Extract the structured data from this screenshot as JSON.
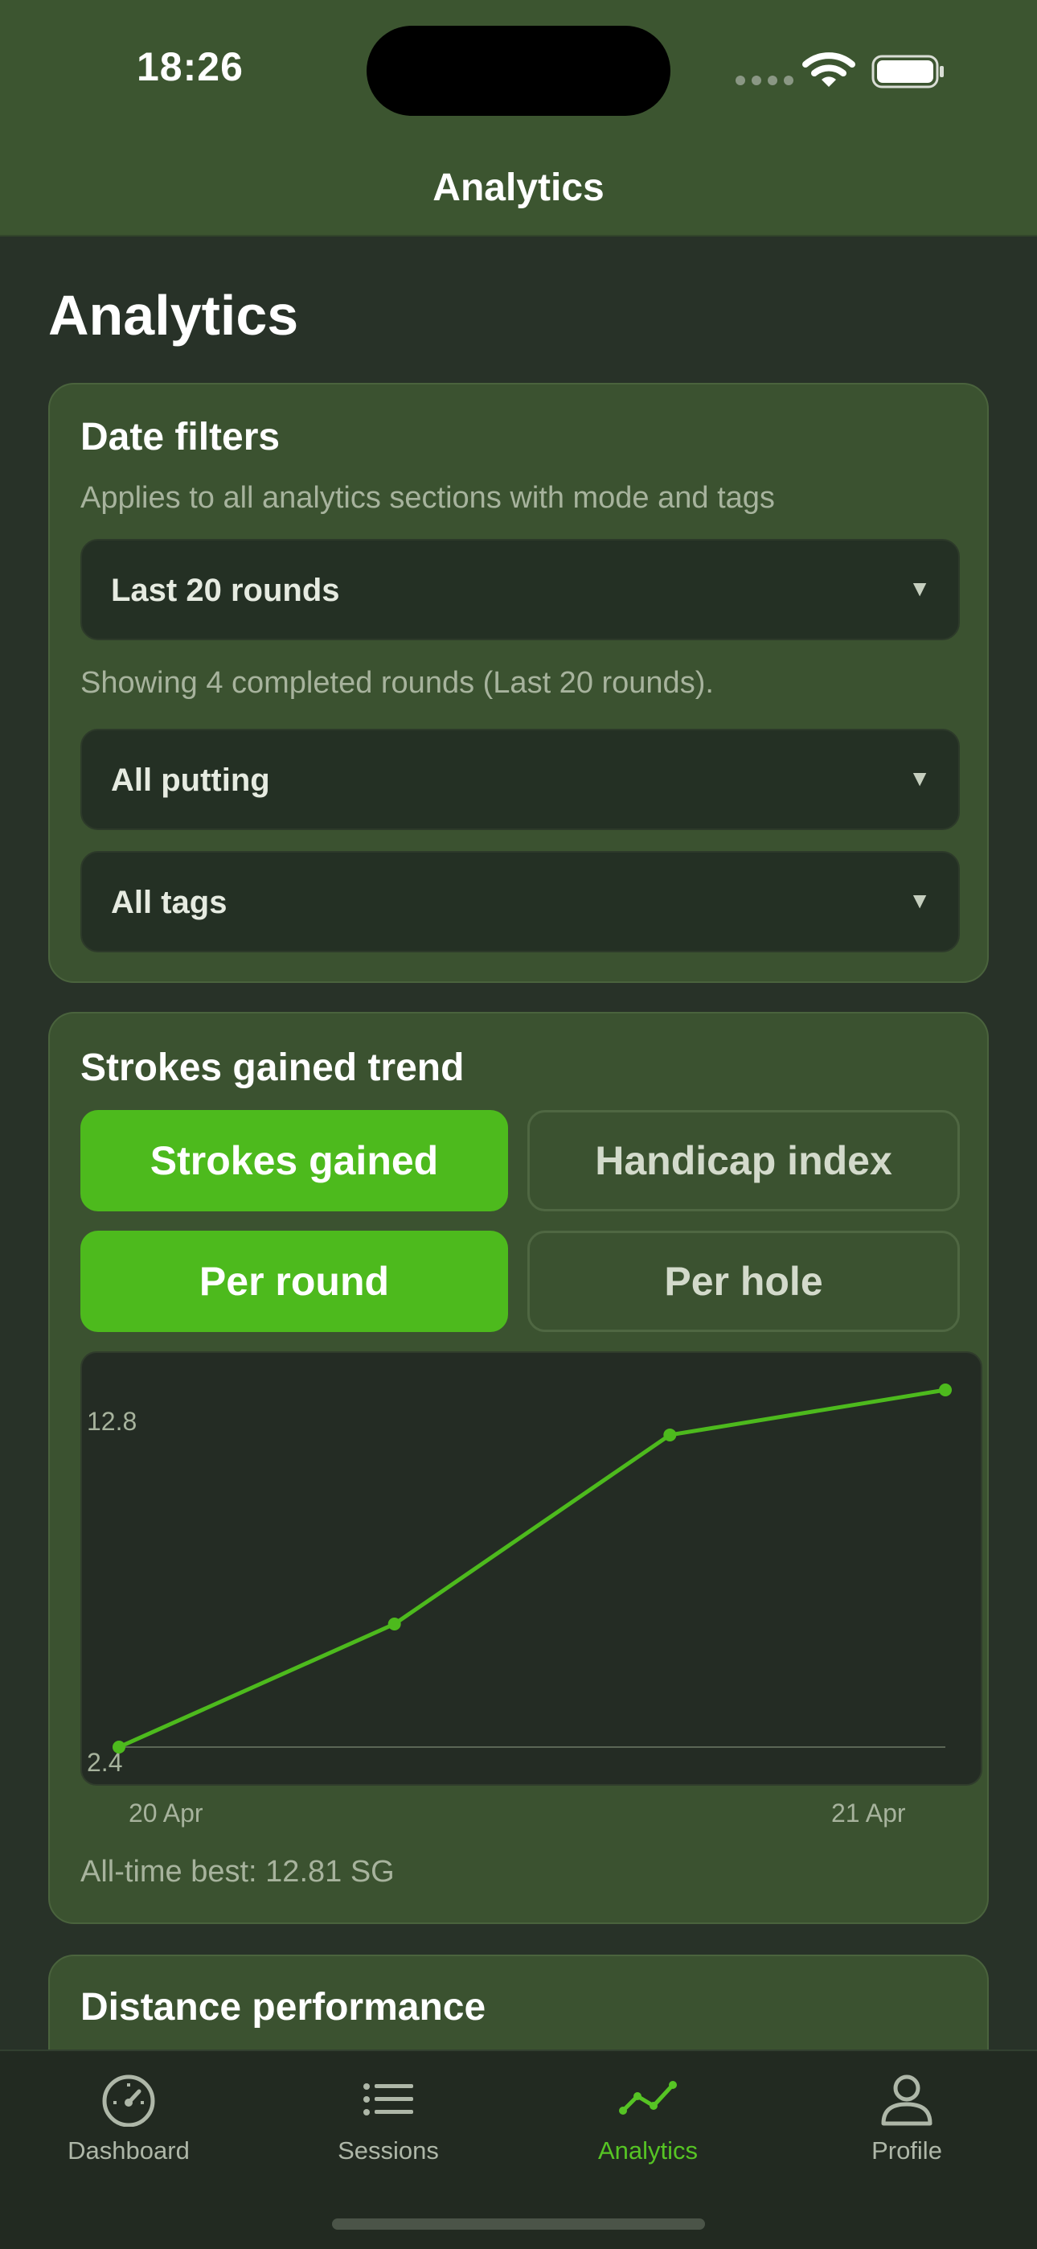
{
  "status_bar": {
    "time": "18:26"
  },
  "nav": {
    "title": "Analytics"
  },
  "page": {
    "title": "Analytics"
  },
  "date_filters": {
    "title": "Date filters",
    "subtitle": "Applies to all analytics sections with mode and tags",
    "range_select": "Last 20 rounds",
    "summary": "Showing 4 completed rounds (Last 20 rounds).",
    "mode_select": "All putting",
    "tags_select": "All tags"
  },
  "trend": {
    "title": "Strokes gained trend",
    "metric_options": [
      "Strokes gained",
      "Handicap index"
    ],
    "metric_selected": "Strokes gained",
    "scope_options": [
      "Per round",
      "Per hole"
    ],
    "scope_selected": "Per round",
    "best_text": "All-time best: 12.81 SG"
  },
  "chart_data": {
    "type": "line",
    "x": [
      "20 Apr",
      "20 Apr",
      "21 Apr",
      "21 Apr"
    ],
    "x_tick_labels": [
      "20 Apr",
      "21 Apr"
    ],
    "series": [
      {
        "values": [
          2.4,
          6.5,
          12.8,
          14.3
        ]
      }
    ],
    "y_tick_labels": [
      "12.8",
      "2.4"
    ],
    "ylim": [
      2.4,
      14.3
    ],
    "line_color": "#4dba1d",
    "grid": false
  },
  "distance": {
    "title": "Distance performance"
  },
  "tabbar": {
    "items": [
      {
        "label": "Dashboard",
        "icon": "gauge-icon"
      },
      {
        "label": "Sessions",
        "icon": "list-icon"
      },
      {
        "label": "Analytics",
        "icon": "line-chart-icon"
      },
      {
        "label": "Profile",
        "icon": "person-icon"
      }
    ],
    "active": "Analytics"
  },
  "colors": {
    "accent": "#4dba1d",
    "header": "#3c5530",
    "card": "#3b5230",
    "background": "#283228"
  }
}
